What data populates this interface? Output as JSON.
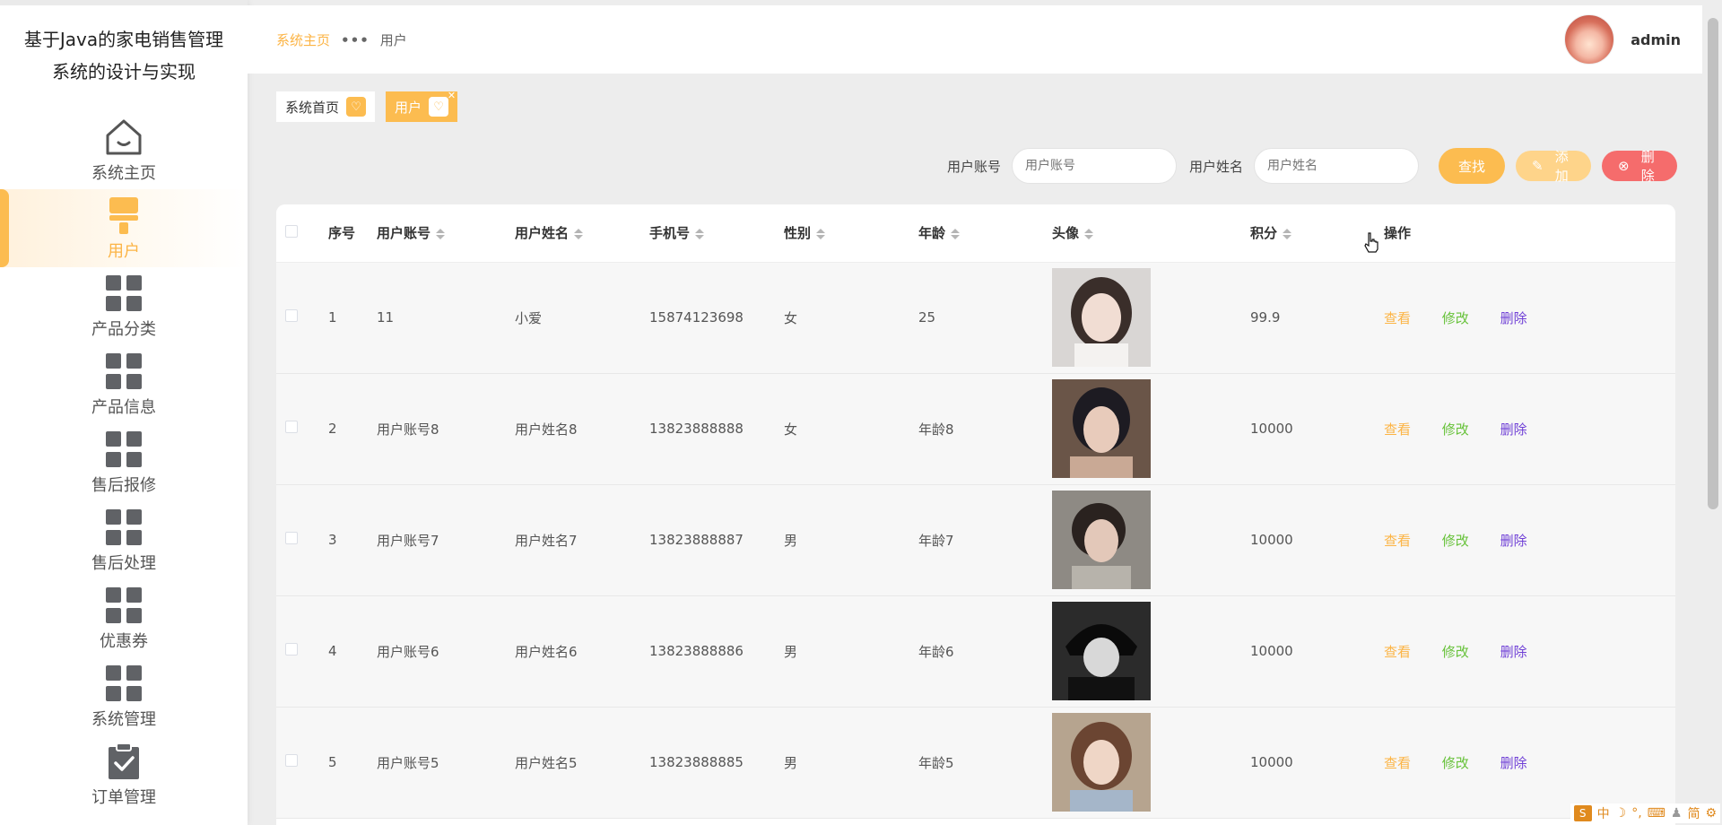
{
  "app": {
    "title": "基于Java的家电销售管理系统的设计与实现"
  },
  "sidebar": {
    "items": [
      {
        "label": "系统主页",
        "icon": "home-icon",
        "active": false
      },
      {
        "label": "用户",
        "icon": "brush-icon",
        "active": true
      },
      {
        "label": "产品分类",
        "icon": "grid-icon",
        "active": false
      },
      {
        "label": "产品信息",
        "icon": "grid-icon",
        "active": false
      },
      {
        "label": "售后报修",
        "icon": "grid-icon",
        "active": false
      },
      {
        "label": "售后处理",
        "icon": "grid-icon",
        "active": false
      },
      {
        "label": "优惠券",
        "icon": "grid-icon",
        "active": false
      },
      {
        "label": "系统管理",
        "icon": "grid-icon",
        "active": false
      },
      {
        "label": "订单管理",
        "icon": "clipboard-check-icon",
        "active": false
      }
    ]
  },
  "header": {
    "breadcrumb_home": "系统主页",
    "breadcrumb_sep": "•••",
    "breadcrumb_current": "用户",
    "username": "admin"
  },
  "tags": [
    {
      "label": "系统首页",
      "active": false
    },
    {
      "label": "用户",
      "active": true
    }
  ],
  "search": {
    "account_label": "用户账号",
    "account_placeholder": "用户账号",
    "name_label": "用户姓名",
    "name_placeholder": "用户姓名",
    "find_label": "查找",
    "add_label": "添加",
    "delete_label": "删除"
  },
  "table": {
    "headers": [
      "序号",
      "用户账号",
      "用户姓名",
      "手机号",
      "性别",
      "年龄",
      "头像",
      "积分",
      "操作"
    ],
    "actions": {
      "view": "查看",
      "edit": "修改",
      "delete": "删除"
    },
    "rows": [
      {
        "index": "1",
        "account": "11",
        "name": "小爱",
        "phone": "15874123698",
        "gender": "女",
        "age": "25",
        "points": "99.9"
      },
      {
        "index": "2",
        "account": "用户账号8",
        "name": "用户姓名8",
        "phone": "13823888888",
        "gender": "女",
        "age": "年龄8",
        "points": "10000"
      },
      {
        "index": "3",
        "account": "用户账号7",
        "name": "用户姓名7",
        "phone": "13823888887",
        "gender": "男",
        "age": "年龄7",
        "points": "10000"
      },
      {
        "index": "4",
        "account": "用户账号6",
        "name": "用户姓名6",
        "phone": "13823888886",
        "gender": "男",
        "age": "年龄6",
        "points": "10000"
      },
      {
        "index": "5",
        "account": "用户账号5",
        "name": "用户姓名5",
        "phone": "13823888885",
        "gender": "男",
        "age": "年龄5",
        "points": "10000"
      }
    ]
  },
  "ime": {
    "lang": "中",
    "mode": "简"
  },
  "colors": {
    "accent": "#fcbc50",
    "danger": "#f56c6c",
    "edit": "#67c23a",
    "delete_link": "#6f3fd6"
  }
}
